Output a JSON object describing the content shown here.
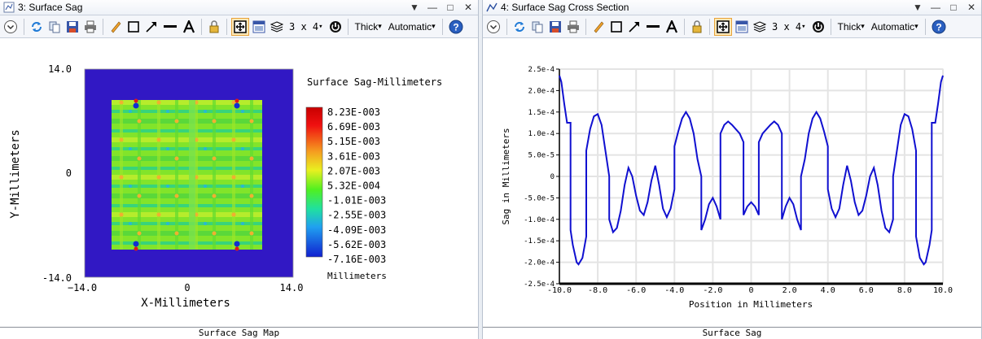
{
  "windows": [
    {
      "title": "3: Surface Sag",
      "footer": "Surface Sag Map",
      "toolbar": {
        "layout": "3 x 4",
        "line": "Thick",
        "scale": "Automatic"
      }
    },
    {
      "title": "4: Surface Sag Cross Section",
      "footer": "Surface Sag",
      "toolbar": {
        "layout": "3 x 4",
        "line": "Thick",
        "scale": "Automatic"
      }
    }
  ],
  "titlebar_controls": [
    "▼",
    "—",
    "□",
    "✕"
  ],
  "map": {
    "ylabel": "Y-Millimeters",
    "xlabel": "X-Millimeters",
    "yticks": [
      "14.0",
      "0",
      "-14.0"
    ],
    "xticks": [
      "−14.0",
      "0",
      "14.0"
    ],
    "legend_title": "Surface Sag-Millimeters",
    "legend_unit": "Millimeters",
    "legend_values": [
      "8.23E-003",
      "6.69E-003",
      "5.15E-003",
      "3.61E-003",
      "2.07E-003",
      "5.32E-004",
      "-1.01E-003",
      "-2.55E-003",
      "-4.09E-003",
      "-5.62E-003",
      "-7.16E-003"
    ],
    "background_color": "#3118c4"
  },
  "chart_data": {
    "type": "line",
    "xlabel": "Position in Millimeters",
    "ylabel": "Sag in Millimeters",
    "xlim": [
      -10.0,
      10.0
    ],
    "ylim": [
      -0.00025,
      0.00025
    ],
    "xticks": [
      "-10.0",
      "-8.0",
      "-6.0",
      "-4.0",
      "-2.0",
      "0",
      "2.0",
      "4.0",
      "6.0",
      "8.0",
      "10.0"
    ],
    "yticks": [
      "2.5e-4",
      "2.0e-4",
      "1.5e-4",
      "1.0e-4",
      "5.0e-5",
      "0",
      "-5.0e-5",
      "-1.0e-4",
      "-1.5e-4",
      "-2.0e-4",
      "-2.5e-4"
    ],
    "line_color": "#1010d0",
    "x": [
      -10.0,
      -9.9,
      -9.75,
      -9.6,
      -9.42,
      -9.42,
      -9.3,
      -9.1,
      -9.0,
      -8.8,
      -8.6,
      -8.6,
      -8.4,
      -8.2,
      -8.0,
      -7.8,
      -7.6,
      -7.4,
      -7.4,
      -7.2,
      -7.0,
      -6.8,
      -6.6,
      -6.4,
      -6.2,
      -6.0,
      -5.8,
      -5.6,
      -5.4,
      -5.2,
      -5.0,
      -4.8,
      -4.6,
      -4.4,
      -4.2,
      -4.0,
      -4.0,
      -3.8,
      -3.6,
      -3.4,
      -3.2,
      -3.0,
      -2.8,
      -2.6,
      -2.6,
      -2.4,
      -2.2,
      -2.0,
      -1.8,
      -1.6,
      -1.6,
      -1.4,
      -1.2,
      -1.0,
      -0.8,
      -0.6,
      -0.4,
      -0.4,
      -0.2,
      0.0,
      0.2,
      0.4,
      0.4,
      0.6,
      0.8,
      1.0,
      1.2,
      1.4,
      1.6,
      1.6,
      1.8,
      2.0,
      2.2,
      2.4,
      2.6,
      2.6,
      2.8,
      3.0,
      3.2,
      3.4,
      3.6,
      3.8,
      4.0,
      4.0,
      4.2,
      4.4,
      4.6,
      4.8,
      5.0,
      5.2,
      5.4,
      5.6,
      5.8,
      6.0,
      6.2,
      6.4,
      6.6,
      6.8,
      7.0,
      7.2,
      7.4,
      7.4,
      7.6,
      7.8,
      8.0,
      8.2,
      8.4,
      8.6,
      8.6,
      8.8,
      9.0,
      9.1,
      9.3,
      9.42,
      9.42,
      9.6,
      9.75,
      9.9,
      10.0
    ],
    "y": [
      0.000235,
      0.00022,
      0.00017,
      0.000125,
      0.000125,
      -0.000125,
      -0.00016,
      -0.0002,
      -0.000205,
      -0.00019,
      -0.00014,
      6e-05,
      0.00011,
      0.00014,
      0.000145,
      0.00012,
      6e-05,
      0.0,
      -0.0001,
      -0.00013,
      -0.00012,
      -8e-05,
      -2e-05,
      2e-05,
      0.0,
      -4.5e-05,
      -8e-05,
      -9e-05,
      -6e-05,
      -1e-05,
      2.5e-05,
      -2e-05,
      -7.5e-05,
      -9.5e-05,
      -7.5e-05,
      -3e-05,
      7e-05,
      0.000105,
      0.000135,
      0.00015,
      0.000135,
      0.0001,
      4e-05,
      0.0,
      -0.000125,
      -0.0001,
      -6.5e-05,
      -5e-05,
      -7e-05,
      -0.0001,
      0.0001,
      0.00012,
      0.000128,
      0.00012,
      0.00011,
      0.0001,
      8e-05,
      -9e-05,
      -7e-05,
      -6e-05,
      -7e-05,
      -9e-05,
      8e-05,
      0.0001,
      0.00011,
      0.00012,
      0.000128,
      0.00012,
      0.0001,
      -0.0001,
      -7e-05,
      -5e-05,
      -6.5e-05,
      -0.0001,
      -0.000125,
      0.0,
      4e-05,
      0.0001,
      0.000135,
      0.00015,
      0.000135,
      0.000105,
      7e-05,
      -3e-05,
      -7.5e-05,
      -9.5e-05,
      -7.5e-05,
      -2e-05,
      2.5e-05,
      -1e-05,
      -6e-05,
      -9e-05,
      -8e-05,
      -4.5e-05,
      0.0,
      2e-05,
      -2e-05,
      -8e-05,
      -0.00012,
      -0.00013,
      -0.0001,
      0.0,
      6e-05,
      0.00012,
      0.000145,
      0.00014,
      0.00011,
      6e-05,
      -0.00014,
      -0.00019,
      -0.000205,
      -0.0002,
      -0.00016,
      -0.000125,
      0.000125,
      0.000125,
      0.00017,
      0.00022,
      0.000235
    ]
  }
}
